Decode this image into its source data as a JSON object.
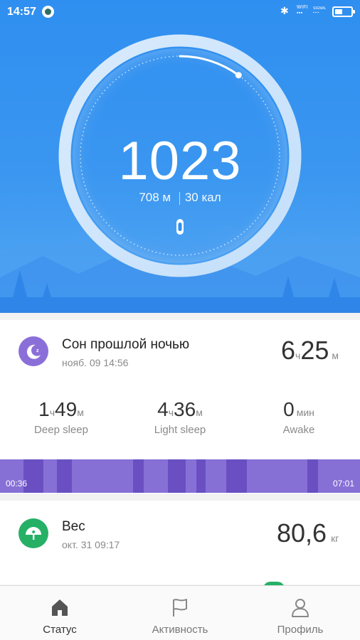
{
  "status_bar": {
    "time": "14:57",
    "wifi_label": "WIFI",
    "signal_label": "SIGNAL",
    "bluetooth_icon": "bluetooth-icon",
    "battery_icon": "battery-icon"
  },
  "hero": {
    "steps": "1023",
    "distance_value": "708",
    "distance_unit": "м",
    "calories_value": "30",
    "calories_unit": "кал",
    "goal_progress_fraction": 0.1
  },
  "sleep": {
    "title": "Сон прошлой ночью",
    "date": "нояб. 09 14:56",
    "total_hours": "6",
    "hours_unit": "ч",
    "total_minutes": "25",
    "minutes_unit": "м",
    "deep": {
      "hours": "1",
      "hours_unit": "ч",
      "minutes": "49",
      "minutes_unit": "м",
      "label": "Deep sleep"
    },
    "light": {
      "hours": "4",
      "hours_unit": "ч",
      "minutes": "36",
      "minutes_unit": "м",
      "label": "Light sleep"
    },
    "awake": {
      "value": "0",
      "unit": "мин",
      "label": "Awake"
    },
    "timeline_start": "00:36",
    "timeline_end": "07:01",
    "colors": {
      "light": "#8670d6",
      "deep": "#6a4fc2"
    }
  },
  "weight": {
    "title": "Вес",
    "date": "окт. 31 09:17",
    "value": "80,6",
    "unit": "кг"
  },
  "nav": {
    "items": [
      {
        "label": "Статус",
        "icon": "home-icon"
      },
      {
        "label": "Активность",
        "icon": "flag-icon"
      },
      {
        "label": "Профиль",
        "icon": "user-icon"
      }
    ]
  },
  "colors": {
    "hero_blue": "#2f8ff0",
    "sleep_purple": "#8b6fd9",
    "weight_green": "#25b066"
  }
}
